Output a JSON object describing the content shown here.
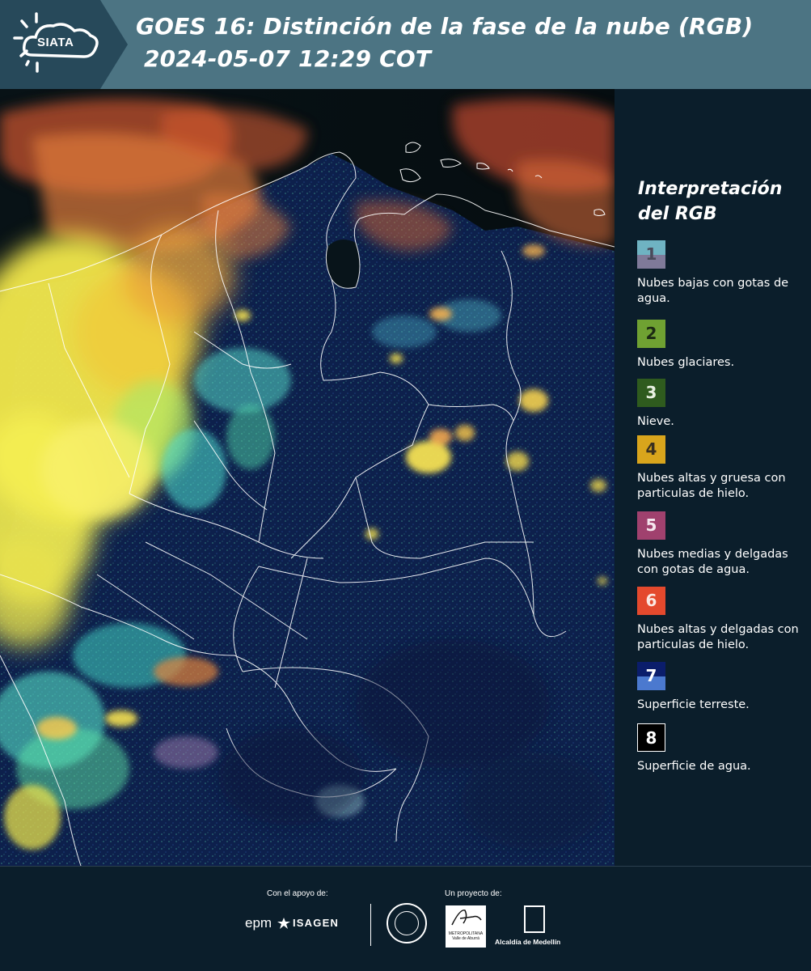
{
  "header": {
    "logo_text": "SIATA",
    "title_line1": "GOES 16: Distinción de la fase de la nube (RGB)",
    "title_line2": "2024-05-07 12:29 COT",
    "background_color": "#4c7483",
    "logo_background_color": "#27495a"
  },
  "legend": {
    "title": "Interpretación del RGB",
    "items": [
      {
        "number": "1",
        "label": "Nubes bajas con gotas de agua.",
        "color_top": "#6fb3c2",
        "color_bottom": "#7f7a99",
        "number_color": "#4a4a5a"
      },
      {
        "number": "2",
        "label": "Nubes glaciares.",
        "color_top": "#6fa132",
        "color_bottom": "#6fa132",
        "number_color": "#1c2a14"
      },
      {
        "number": "3",
        "label": "Nieve.",
        "color_top": "#2f5b1e",
        "color_bottom": "#2f5b1e",
        "number_color": "#e8f0e0"
      },
      {
        "number": "4",
        "label": "Nubes altas y gruesa con particulas de hielo.",
        "color_top": "#d9a51c",
        "color_bottom": "#d9a51c",
        "number_color": "#3a3020"
      },
      {
        "number": "5",
        "label": "Nubes medias y delgadas con gotas de agua.",
        "color_top": "#a0416e",
        "color_bottom": "#a0416e",
        "number_color": "#f5e6ee"
      },
      {
        "number": "6",
        "label": "Nubes altas y delgadas con particulas de hielo.",
        "color_top": "#e4492d",
        "color_bottom": "#e4492d",
        "number_color": "#fbe8e2"
      },
      {
        "number": "7",
        "label": "Superficie terreste.",
        "color_top": "#0b1d6b",
        "color_bottom": "#4b79cf",
        "number_color": "#ffffff"
      },
      {
        "number": "8",
        "label": "Superficie de agua.",
        "color_top": "#000000",
        "color_bottom": "#000000",
        "number_color": "#ffffff"
      }
    ]
  },
  "footer": {
    "support_label": "Con el apoyo de:",
    "project_label": "Un proyecto de:",
    "epm_text": "epm",
    "isagen_text": "ISAGEN",
    "area_text": "METROPOLITANA Valle de Aburrá",
    "alcaldia_text": "Alcaldía de Medellín"
  },
  "colors": {
    "panel_background": "#0b1e2b",
    "land_surface": "#0d1f4a",
    "water_surface": "#050d10",
    "high_cloud_yellow": "#f4ee52",
    "thin_ice_cloud": "#e06a3a",
    "low_water_cloud": "#55e0c8",
    "boundary_line": "#ffffff"
  }
}
